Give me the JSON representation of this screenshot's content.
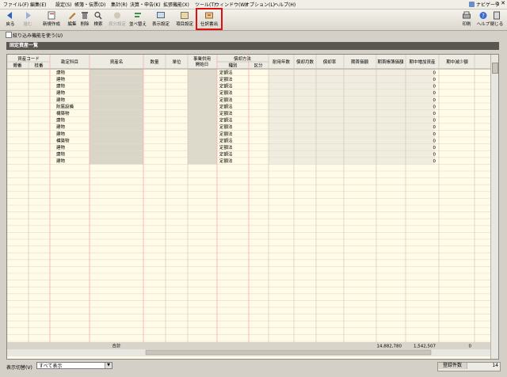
{
  "menu": {
    "items": [
      "ファイル(F)",
      "編集(E)",
      "設定(S)",
      "帳簿・伝票(D)",
      "集計(R)",
      "決算・申告(K)",
      "拡張機能(X)",
      "ツール(T)",
      "ウィンドウ(W)",
      "オプション(L)",
      "ヘルプ(H)"
    ],
    "navigator": "ナビゲータ"
  },
  "toolbar": {
    "back": "戻る",
    "forward": "進む",
    "new": "新規作成",
    "edit": "編集",
    "delete": "削除",
    "search": "検索",
    "allocate": "按分設定",
    "sort": "並べ替え",
    "display": "表示設定",
    "items": "項目設定",
    "journal": "仕訳書出",
    "print": "印刷",
    "help": "ヘルプ",
    "close": "閉じる"
  },
  "filter": {
    "label": "絞り込み機能を使う(U)"
  },
  "panel": {
    "title": "固定資産一覧"
  },
  "table": {
    "headers": {
      "asset_code": "資産コード",
      "parent": "親番",
      "child": "枝番",
      "account": "勘定科目",
      "name": "資産名",
      "quantity": "数量",
      "unit": "単位",
      "start_date": "事業供用開始日",
      "method": "償却方法",
      "method_type": "種別",
      "method_class": "区分",
      "life": "耐用年数",
      "months": "償却月数",
      "rate": "償却率",
      "opening_value": "期首価額",
      "opening_accum": "期首帳簿価額",
      "increase": "期中増加資産",
      "decrease": "期中減少額"
    },
    "rows": [
      {
        "account": "建物",
        "method": "定額法",
        "increase": "0"
      },
      {
        "account": "建物",
        "method": "定額法",
        "increase": "0"
      },
      {
        "account": "建物",
        "method": "定額法",
        "increase": "0"
      },
      {
        "account": "建物",
        "method": "定額法",
        "increase": "0"
      },
      {
        "account": "建物",
        "method": "定額法",
        "increase": "0"
      },
      {
        "account": "附属設備",
        "method": "定額法",
        "increase": "0"
      },
      {
        "account": "構築物",
        "method": "定額法",
        "increase": "0"
      },
      {
        "account": "建物",
        "method": "定額法",
        "increase": "0"
      },
      {
        "account": "建物",
        "method": "定額法",
        "increase": "0"
      },
      {
        "account": "建物",
        "method": "定額法",
        "increase": "0"
      },
      {
        "account": "構築物",
        "method": "定額法",
        "increase": "0"
      },
      {
        "account": "建物",
        "method": "定額法",
        "increase": "0"
      },
      {
        "account": "建物",
        "method": "定額法",
        "increase": "0"
      },
      {
        "account": "建物",
        "method": "定額法",
        "increase": "0"
      }
    ],
    "total": {
      "label": "合計",
      "opening_value": "14,882,780",
      "opening_accum": "1,542,507",
      "increase": "0"
    }
  },
  "status": {
    "view_label": "表示切替(V)",
    "view_value": "すべて表示",
    "count_label": "登録件数",
    "count": "14"
  },
  "colors": {
    "highlight": "#e01010",
    "titlebar": "#5a5650",
    "grid_bg": "#fffbe8",
    "pink_line": "#f0b0b8"
  }
}
